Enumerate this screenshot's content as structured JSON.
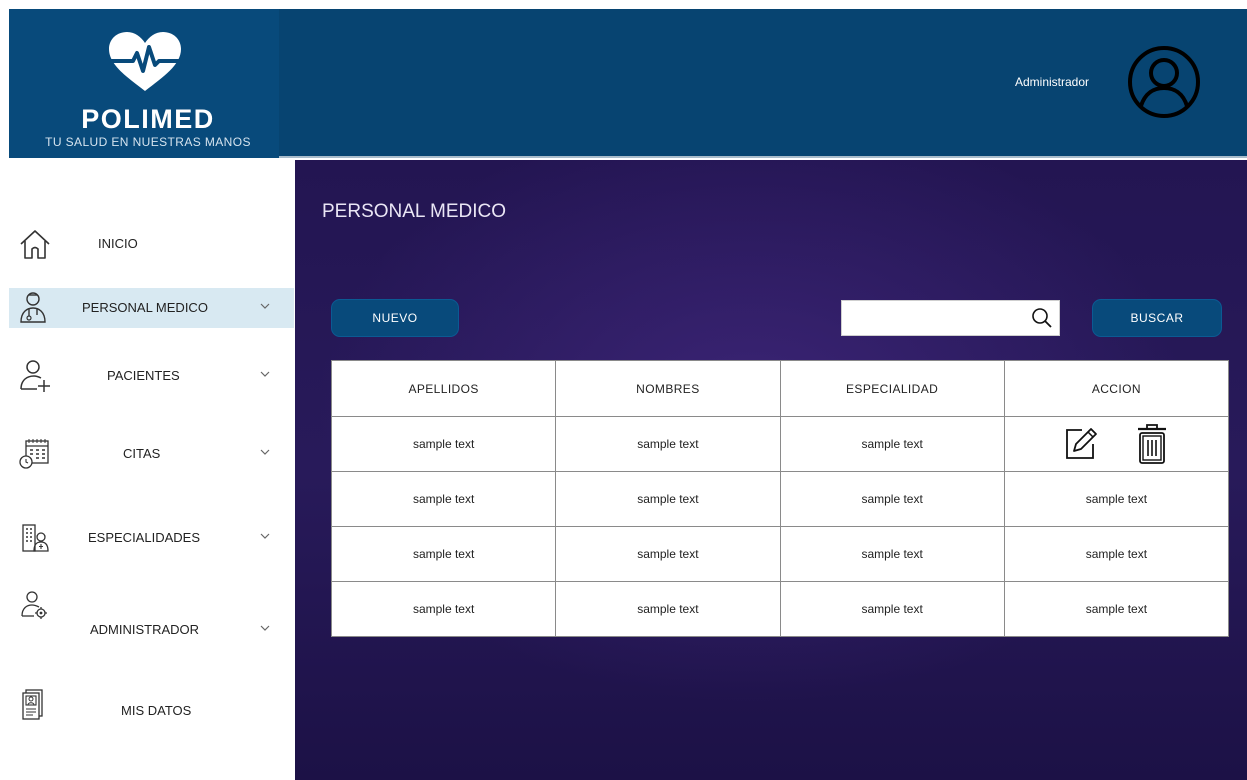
{
  "brand": {
    "name": "POLIMED",
    "tagline": "TU SALUD EN NUESTRAS MANOS"
  },
  "header": {
    "user_label": "Administrador"
  },
  "sidebar": {
    "items": [
      {
        "label": "INICIO",
        "icon": "home-icon"
      },
      {
        "label": "PERSONAL MEDICO",
        "icon": "doctor-icon",
        "active": true
      },
      {
        "label": "PACIENTES",
        "icon": "add-patient-icon"
      },
      {
        "label": "CITAS",
        "icon": "calendar-icon"
      },
      {
        "label": "ESPECIALIDADES",
        "icon": "hospital-icon"
      },
      {
        "label": "ADMINISTRADOR",
        "icon": "admin-icon"
      },
      {
        "label": "MIS DATOS",
        "icon": "profile-card-icon"
      }
    ]
  },
  "main": {
    "title": "PERSONAL MEDICO",
    "new_button": "NUEVO",
    "search_button": "BUSCAR",
    "search_value": "",
    "table": {
      "headers": [
        "APELLIDOS",
        "NOMBRES",
        "ESPECIALIDAD",
        "ACCION"
      ],
      "rows": [
        [
          "sample text",
          "sample text",
          "sample text",
          ""
        ],
        [
          "sample text",
          "sample text",
          "sample text",
          "sample text"
        ],
        [
          "sample text",
          "sample text",
          "sample text",
          "sample text"
        ],
        [
          "sample text",
          "sample text",
          "sample text",
          "sample text"
        ]
      ]
    }
  },
  "colors": {
    "header_bg": "#074471",
    "button_bg": "#084a7b",
    "main_bg": "#231552",
    "active_item_bg": "#d8e9f2"
  }
}
